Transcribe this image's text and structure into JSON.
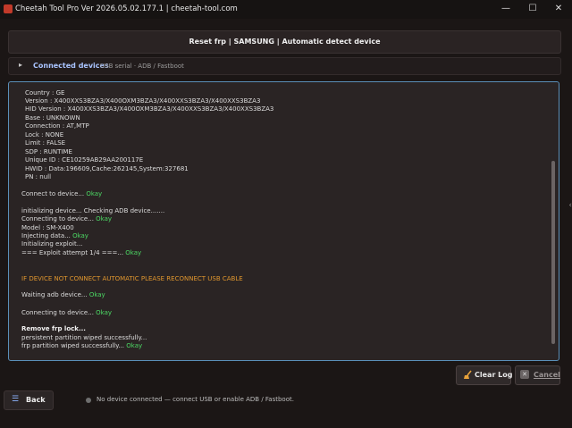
{
  "window": {
    "title": "Cheetah Tool Pro Ver 2026.05.02.177.1 | cheetah-tool.com",
    "controls": {
      "minimize": "—",
      "maximize": "☐",
      "close": "✕"
    }
  },
  "header": {
    "title": "Reset frp | SAMSUNG | Automatic detect device"
  },
  "connected": {
    "chevron": "▸",
    "label": "Connected devices",
    "sub": "USB serial · ADB / Fastboot"
  },
  "log": {
    "info": {
      "country": "Country      : GE",
      "version": "Version     : X400XXS3BZA3/X400OXM3BZA3/X400XXS3BZA3/X400XXS3BZA3",
      "hid": "HID Version : X400XXS3BZA3/X400OXM3BZA3/X400XXS3BZA3/X400XXS3BZA3",
      "base": "Base        : UNKNOWN",
      "connection": "Connection  : AT,MTP",
      "lock": "Lock         : NONE",
      "limit": "Limit        : FALSE",
      "sdp": "SDP          : RUNTIME",
      "unique": "Unique ID    : CE10259AB29AA200117E",
      "hwid": "HWID         : Data:196609,Cache:262145,System:327681",
      "pn": "PN           : null"
    },
    "connect1": "Connect to device...",
    "initializing": "initializing device... Checking ADB device.......",
    "connecting": "Connecting to device...",
    "model": "Model : SM-X400",
    "injecting": "Injecting data...",
    "init_exploit": "Initializing exploit...",
    "attempt": "=== Exploit attempt 1/4 ===...",
    "warning": "IF DEVICE NOT CONNECT AUTOMATIC PLEASE RECONNECT USB CABLE",
    "waiting": "Waiting adb device...",
    "connecting2": "Connecting to device...",
    "remove": "Remove frp lock...",
    "persistent": "persistent partition wiped successfully...",
    "frp": "frp partition wiped successfully...",
    "ok": "Okay"
  },
  "buttons": {
    "clear_log": "Clear Log",
    "cancel": "Cancel",
    "back": "Back"
  },
  "status": {
    "text": "No device connected — connect USB or enable ADB / Fastboot."
  },
  "colors": {
    "accent": "#5a8fb8",
    "ok": "#4cd964",
    "warn": "#e0962e"
  }
}
